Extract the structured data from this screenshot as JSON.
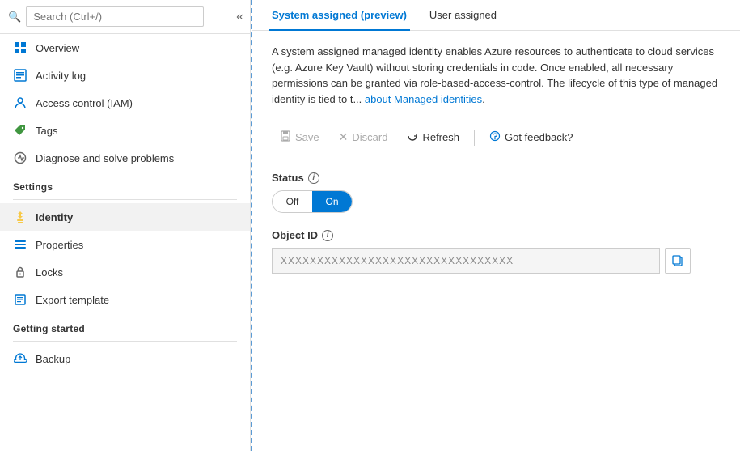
{
  "search": {
    "placeholder": "Search (Ctrl+/)"
  },
  "sidebar": {
    "nav_items": [
      {
        "id": "overview",
        "label": "Overview",
        "icon": "⬛",
        "icon_color": "icon-overview",
        "active": false
      },
      {
        "id": "activity-log",
        "label": "Activity log",
        "icon": "📋",
        "icon_color": "icon-activity",
        "active": false
      },
      {
        "id": "access-control",
        "label": "Access control (IAM)",
        "icon": "👤",
        "icon_color": "icon-iam",
        "active": false
      },
      {
        "id": "tags",
        "label": "Tags",
        "icon": "🏷",
        "icon_color": "icon-tags",
        "active": false
      },
      {
        "id": "diagnose",
        "label": "Diagnose and solve problems",
        "icon": "🔧",
        "icon_color": "icon-diagnose",
        "active": false
      }
    ],
    "settings_section": "Settings",
    "settings_items": [
      {
        "id": "identity",
        "label": "Identity",
        "icon": "🔑",
        "icon_color": "icon-identity",
        "active": true
      },
      {
        "id": "properties",
        "label": "Properties",
        "icon": "≡",
        "icon_color": "icon-properties",
        "active": false
      },
      {
        "id": "locks",
        "label": "Locks",
        "icon": "🔒",
        "icon_color": "icon-locks",
        "active": false
      },
      {
        "id": "export-template",
        "label": "Export template",
        "icon": "⬜",
        "icon_color": "icon-export",
        "active": false
      }
    ],
    "getting_started_section": "Getting started",
    "getting_started_items": [
      {
        "id": "backup",
        "label": "Backup",
        "icon": "☁",
        "icon_color": "icon-backup",
        "active": false
      }
    ]
  },
  "main": {
    "tabs": [
      {
        "id": "system-assigned",
        "label": "System assigned (preview)",
        "active": true
      },
      {
        "id": "user-assigned",
        "label": "User assigned",
        "active": false
      }
    ],
    "description": "A system assigned managed identity enables Azure resources to authenticate to cloud services (e.g. Azure Key Vault) without storing credentials in code. Once enabled, all necessary permissions can be granted via role-based-access-control. The lifecycle of this type of managed identity is tied to t...",
    "link_text": "about Managed identities",
    "link_href": "#",
    "toolbar": {
      "save_label": "Save",
      "discard_label": "Discard",
      "refresh_label": "Refresh",
      "feedback_label": "Got feedback?"
    },
    "status_label": "Status",
    "toggle_off": "Off",
    "toggle_on": "On",
    "object_id_label": "Object ID",
    "object_id_placeholder": "XXXXXXXXXXXXXXXXXXXXXXXXXXXXXXXX",
    "object_id_value": "XXXXXXXXXXXXXXXXXXXXXXXXXXXXXXXX"
  }
}
